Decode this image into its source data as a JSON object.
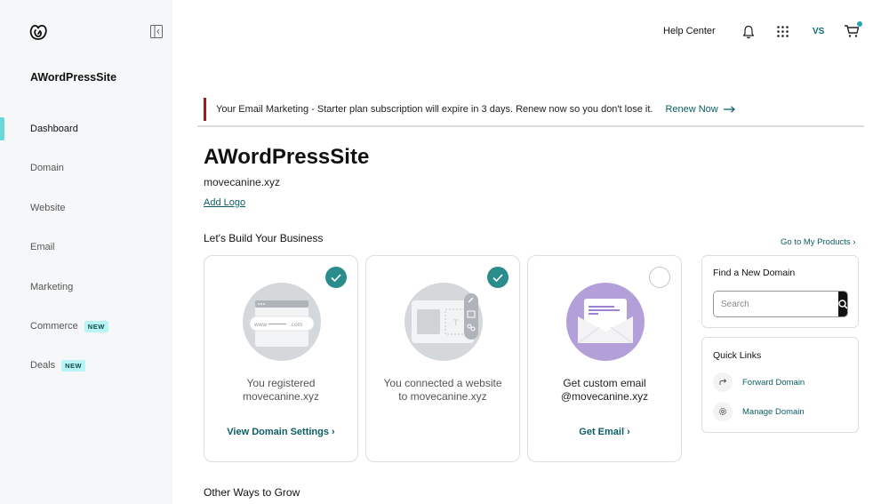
{
  "sidebar": {
    "site_name": "AWordPressSite",
    "items": [
      {
        "label": "Dashboard",
        "active": true
      },
      {
        "label": "Domain"
      },
      {
        "label": "Website"
      },
      {
        "label": "Email"
      },
      {
        "label": "Marketing"
      },
      {
        "label": "Commerce",
        "badge": "NEW"
      },
      {
        "label": "Deals",
        "badge": "NEW"
      }
    ]
  },
  "topbar": {
    "help": "Help Center",
    "user_initials": "VS",
    "icons": [
      "bell-icon",
      "apps-grid-icon",
      "cart-icon"
    ]
  },
  "alert": {
    "text": "Your Email Marketing - Starter plan subscription will expire in 3 days. Renew now so you don't lose it.",
    "action": "Renew Now"
  },
  "main": {
    "title": "AWordPressSite",
    "domain": "movecanine.xyz",
    "add_logo": "Add Logo",
    "build_title": "Let's Build Your Business",
    "goto_products": "Go to My Products ›",
    "other_title": "Other Ways to Grow",
    "cards": [
      {
        "text": "You registered movecanine.xyz",
        "link": "View Domain Settings ›",
        "done": true,
        "illustration_text": "www ——— .com"
      },
      {
        "text": "You connected a website to movecanine.xyz",
        "link": "",
        "done": true
      },
      {
        "text": "Get custom email @movecanine.xyz",
        "link": "Get Email ›",
        "done": false
      }
    ]
  },
  "find_domain": {
    "title": "Find a New Domain",
    "placeholder": "Search"
  },
  "quick_links": {
    "title": "Quick Links",
    "items": [
      {
        "label": "Forward Domain",
        "icon": "forward-icon"
      },
      {
        "label": "Manage Domain",
        "icon": "gear-icon"
      }
    ]
  },
  "colors": {
    "accent": "#0b5e63",
    "check": "#2b8c8c",
    "active_bar": "#6ad8d8",
    "alert_bar": "#9d1c1c",
    "email_circle": "#b4a0d9"
  }
}
